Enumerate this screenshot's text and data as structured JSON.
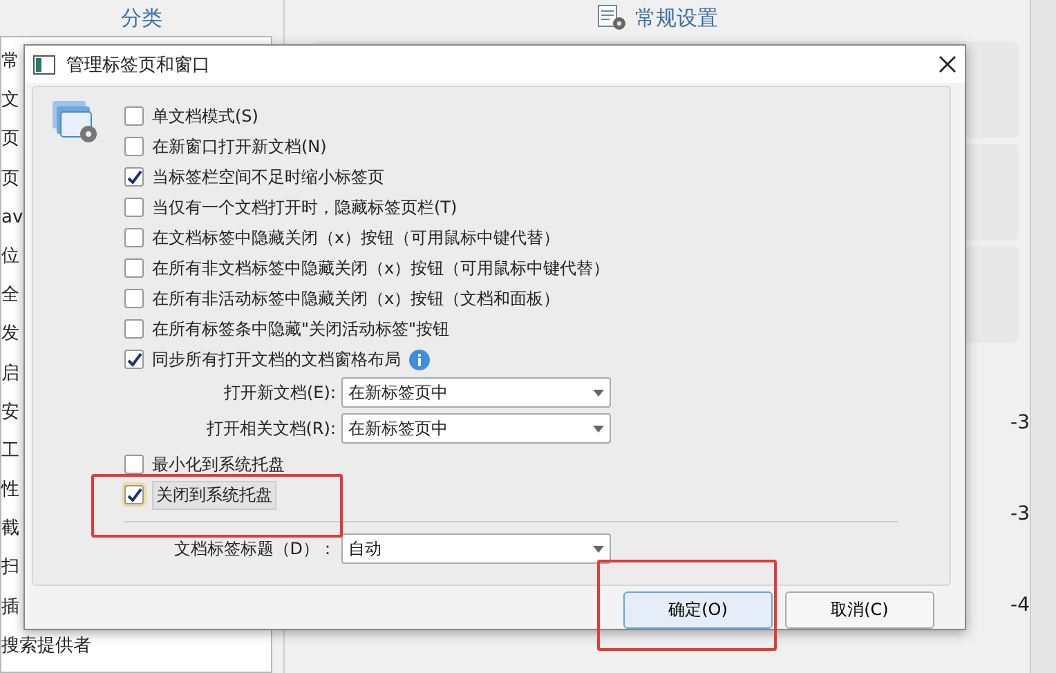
{
  "background": {
    "sidebar_title": "分类",
    "sidebar_items": [
      "常",
      "文",
      "页",
      "页",
      "av",
      "位",
      "全",
      "发",
      "启",
      "安",
      "工",
      "性",
      "截",
      "扫",
      "插",
      "搜索提供者"
    ],
    "settings_title": "常规设置",
    "edge_marks": [
      "-3",
      "-3",
      "-4"
    ]
  },
  "dialog": {
    "title": "管理标签页和窗口",
    "options": [
      {
        "label": "单文档模式(S)",
        "checked": false
      },
      {
        "label": "在新窗口打开新文档(N)",
        "checked": false
      },
      {
        "label": "当标签栏空间不足时缩小标签页",
        "checked": true
      },
      {
        "label": "当仅有一个文档打开时，隐藏标签页栏(T)",
        "checked": false
      },
      {
        "label": "在文档标签中隐藏关闭（x）按钮（可用鼠标中键代替）",
        "checked": false
      },
      {
        "label": "在所有非文档标签中隐藏关闭（x）按钮（可用鼠标中键代替）",
        "checked": false
      },
      {
        "label": "在所有非活动标签中隐藏关闭（x）按钮（文档和面板）",
        "checked": false
      },
      {
        "label": "在所有标签条中隐藏\"关闭活动标签\"按钮",
        "checked": false
      },
      {
        "label": "同步所有打开文档的文档窗格布局",
        "checked": true,
        "info": true
      }
    ],
    "selects": [
      {
        "label": "打开新文档(E):",
        "value": "在新标签页中"
      },
      {
        "label": "打开相关文档(R):",
        "value": "在新标签页中"
      }
    ],
    "tray_options": [
      {
        "label": "最小化到系统托盘",
        "checked": false,
        "highlighted": false
      },
      {
        "label": "关闭到系统托盘",
        "checked": true,
        "highlighted": true
      }
    ],
    "title_select": {
      "label": "文档标签标题（D）：",
      "value": "自动"
    },
    "buttons": [
      {
        "label": "确定(O)",
        "default": true
      },
      {
        "label": "取消(C)",
        "default": false
      }
    ]
  }
}
